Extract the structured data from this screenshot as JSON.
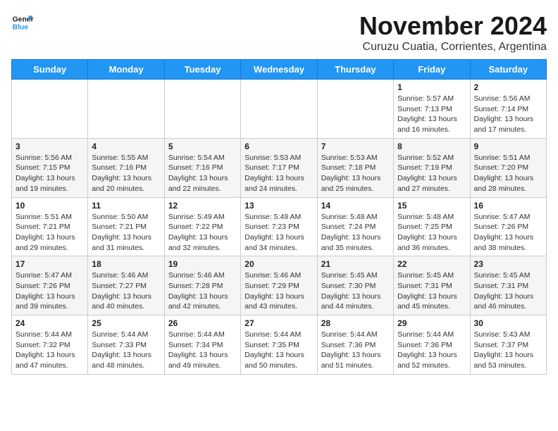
{
  "logo": {
    "line1": "General",
    "line2": "Blue"
  },
  "title": "November 2024",
  "subtitle": "Curuzu Cuatia, Corrientes, Argentina",
  "days_of_week": [
    "Sunday",
    "Monday",
    "Tuesday",
    "Wednesday",
    "Thursday",
    "Friday",
    "Saturday"
  ],
  "weeks": [
    [
      {
        "day": "",
        "content": ""
      },
      {
        "day": "",
        "content": ""
      },
      {
        "day": "",
        "content": ""
      },
      {
        "day": "",
        "content": ""
      },
      {
        "day": "",
        "content": ""
      },
      {
        "day": "1",
        "content": "Sunrise: 5:57 AM\nSunset: 7:13 PM\nDaylight: 13 hours and 16 minutes."
      },
      {
        "day": "2",
        "content": "Sunrise: 5:56 AM\nSunset: 7:14 PM\nDaylight: 13 hours and 17 minutes."
      }
    ],
    [
      {
        "day": "3",
        "content": "Sunrise: 5:56 AM\nSunset: 7:15 PM\nDaylight: 13 hours and 19 minutes."
      },
      {
        "day": "4",
        "content": "Sunrise: 5:55 AM\nSunset: 7:16 PM\nDaylight: 13 hours and 20 minutes."
      },
      {
        "day": "5",
        "content": "Sunrise: 5:54 AM\nSunset: 7:16 PM\nDaylight: 13 hours and 22 minutes."
      },
      {
        "day": "6",
        "content": "Sunrise: 5:53 AM\nSunset: 7:17 PM\nDaylight: 13 hours and 24 minutes."
      },
      {
        "day": "7",
        "content": "Sunrise: 5:53 AM\nSunset: 7:18 PM\nDaylight: 13 hours and 25 minutes."
      },
      {
        "day": "8",
        "content": "Sunrise: 5:52 AM\nSunset: 7:19 PM\nDaylight: 13 hours and 27 minutes."
      },
      {
        "day": "9",
        "content": "Sunrise: 5:51 AM\nSunset: 7:20 PM\nDaylight: 13 hours and 28 minutes."
      }
    ],
    [
      {
        "day": "10",
        "content": "Sunrise: 5:51 AM\nSunset: 7:21 PM\nDaylight: 13 hours and 29 minutes."
      },
      {
        "day": "11",
        "content": "Sunrise: 5:50 AM\nSunset: 7:21 PM\nDaylight: 13 hours and 31 minutes."
      },
      {
        "day": "12",
        "content": "Sunrise: 5:49 AM\nSunset: 7:22 PM\nDaylight: 13 hours and 32 minutes."
      },
      {
        "day": "13",
        "content": "Sunrise: 5:49 AM\nSunset: 7:23 PM\nDaylight: 13 hours and 34 minutes."
      },
      {
        "day": "14",
        "content": "Sunrise: 5:48 AM\nSunset: 7:24 PM\nDaylight: 13 hours and 35 minutes."
      },
      {
        "day": "15",
        "content": "Sunrise: 5:48 AM\nSunset: 7:25 PM\nDaylight: 13 hours and 36 minutes."
      },
      {
        "day": "16",
        "content": "Sunrise: 5:47 AM\nSunset: 7:26 PM\nDaylight: 13 hours and 38 minutes."
      }
    ],
    [
      {
        "day": "17",
        "content": "Sunrise: 5:47 AM\nSunset: 7:26 PM\nDaylight: 13 hours and 39 minutes."
      },
      {
        "day": "18",
        "content": "Sunrise: 5:46 AM\nSunset: 7:27 PM\nDaylight: 13 hours and 40 minutes."
      },
      {
        "day": "19",
        "content": "Sunrise: 5:46 AM\nSunset: 7:28 PM\nDaylight: 13 hours and 42 minutes."
      },
      {
        "day": "20",
        "content": "Sunrise: 5:46 AM\nSunset: 7:29 PM\nDaylight: 13 hours and 43 minutes."
      },
      {
        "day": "21",
        "content": "Sunrise: 5:45 AM\nSunset: 7:30 PM\nDaylight: 13 hours and 44 minutes."
      },
      {
        "day": "22",
        "content": "Sunrise: 5:45 AM\nSunset: 7:31 PM\nDaylight: 13 hours and 45 minutes."
      },
      {
        "day": "23",
        "content": "Sunrise: 5:45 AM\nSunset: 7:31 PM\nDaylight: 13 hours and 46 minutes."
      }
    ],
    [
      {
        "day": "24",
        "content": "Sunrise: 5:44 AM\nSunset: 7:32 PM\nDaylight: 13 hours and 47 minutes."
      },
      {
        "day": "25",
        "content": "Sunrise: 5:44 AM\nSunset: 7:33 PM\nDaylight: 13 hours and 48 minutes."
      },
      {
        "day": "26",
        "content": "Sunrise: 5:44 AM\nSunset: 7:34 PM\nDaylight: 13 hours and 49 minutes."
      },
      {
        "day": "27",
        "content": "Sunrise: 5:44 AM\nSunset: 7:35 PM\nDaylight: 13 hours and 50 minutes."
      },
      {
        "day": "28",
        "content": "Sunrise: 5:44 AM\nSunset: 7:36 PM\nDaylight: 13 hours and 51 minutes."
      },
      {
        "day": "29",
        "content": "Sunrise: 5:44 AM\nSunset: 7:36 PM\nDaylight: 13 hours and 52 minutes."
      },
      {
        "day": "30",
        "content": "Sunrise: 5:43 AM\nSunset: 7:37 PM\nDaylight: 13 hours and 53 minutes."
      }
    ]
  ]
}
